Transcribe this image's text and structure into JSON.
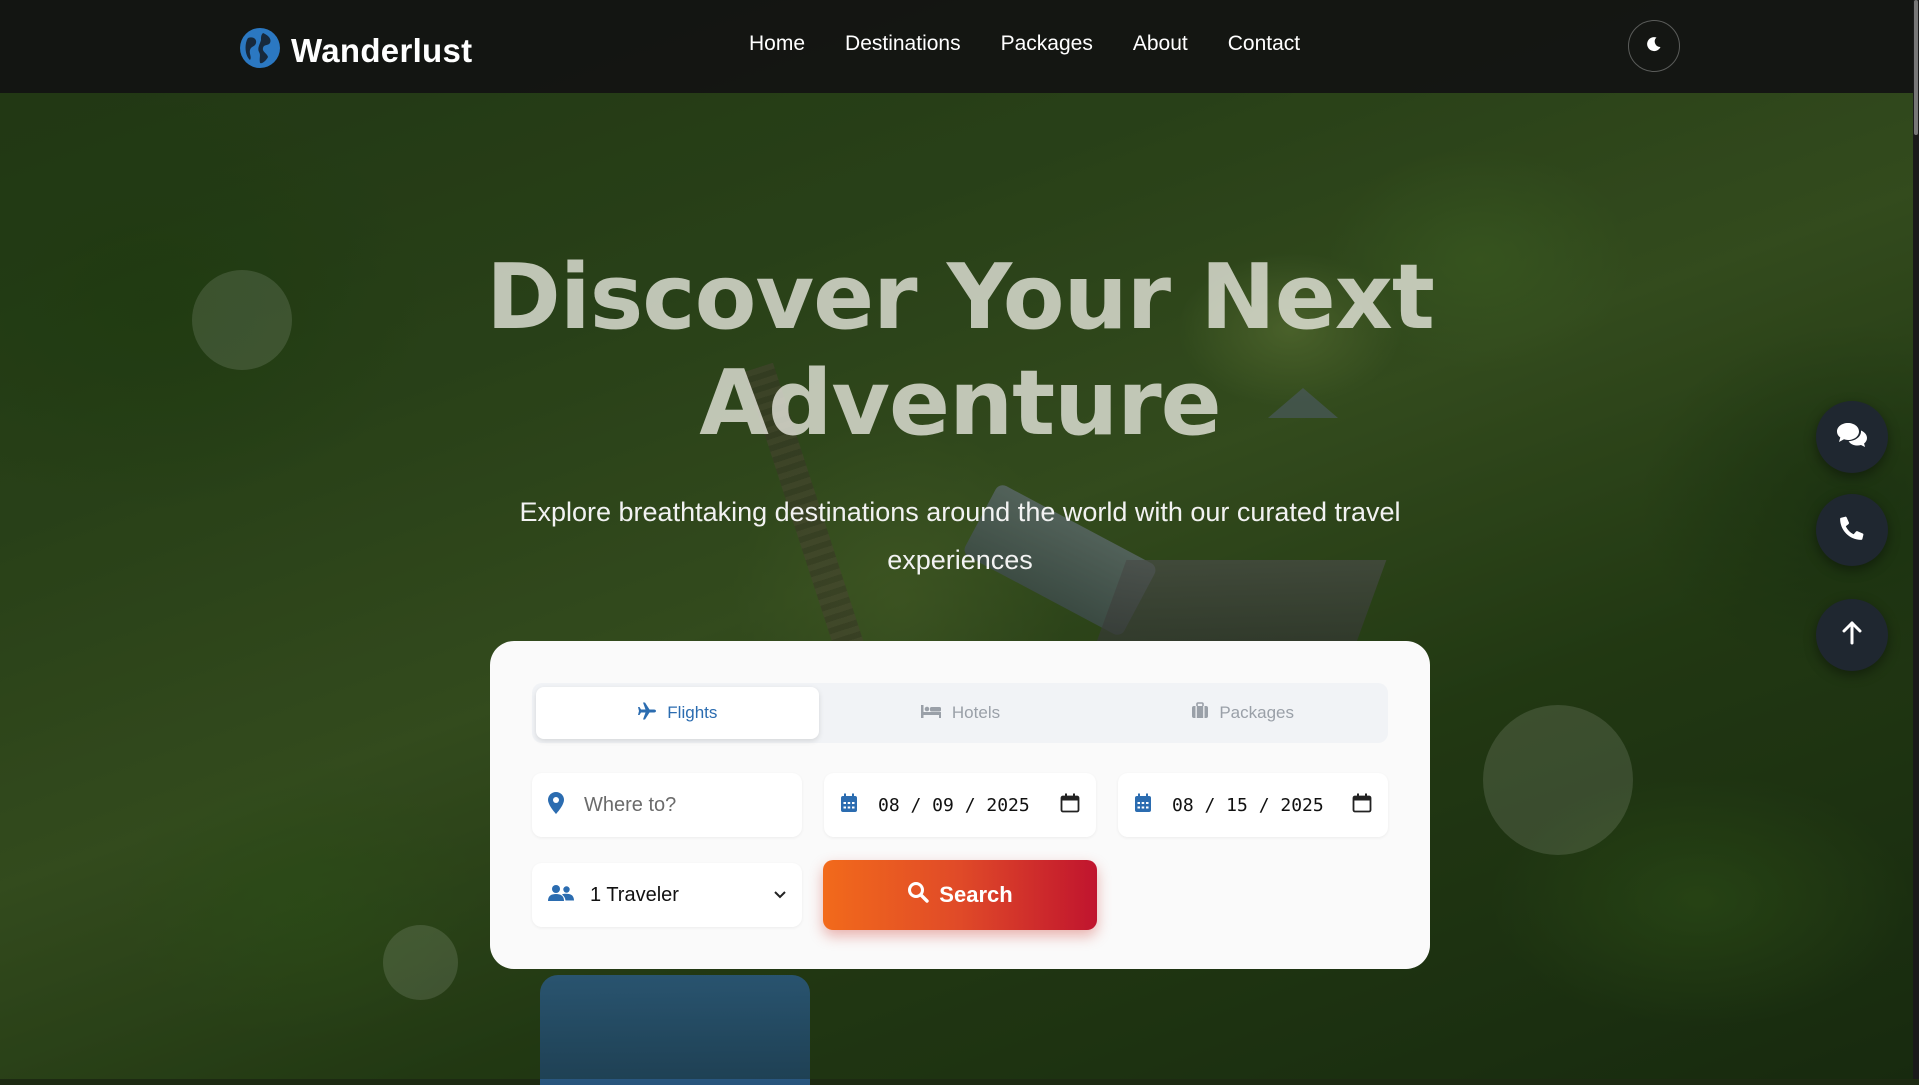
{
  "brand": {
    "name": "Wanderlust"
  },
  "nav": {
    "links": [
      "Home",
      "Destinations",
      "Packages",
      "About",
      "Contact"
    ]
  },
  "hero": {
    "title_line1": "Discover Your Next",
    "title_line2": "Adventure",
    "subtitle": "Explore breathtaking destinations around the world with our curated travel experiences"
  },
  "search": {
    "tabs": [
      {
        "label": "Flights",
        "icon": "plane-icon",
        "active": true
      },
      {
        "label": "Hotels",
        "icon": "bed-icon",
        "active": false
      },
      {
        "label": "Packages",
        "icon": "suitcase-icon",
        "active": false
      }
    ],
    "destination_placeholder": "Where to?",
    "checkin_date": "08 / 09 / 2025",
    "checkout_date": "08 / 15 / 2025",
    "travelers": "1 Traveler",
    "button_label": "Search"
  },
  "colors": {
    "accent_blue": "#2b6cb0",
    "button_start": "#f26a1b",
    "button_end": "#c0142e"
  }
}
